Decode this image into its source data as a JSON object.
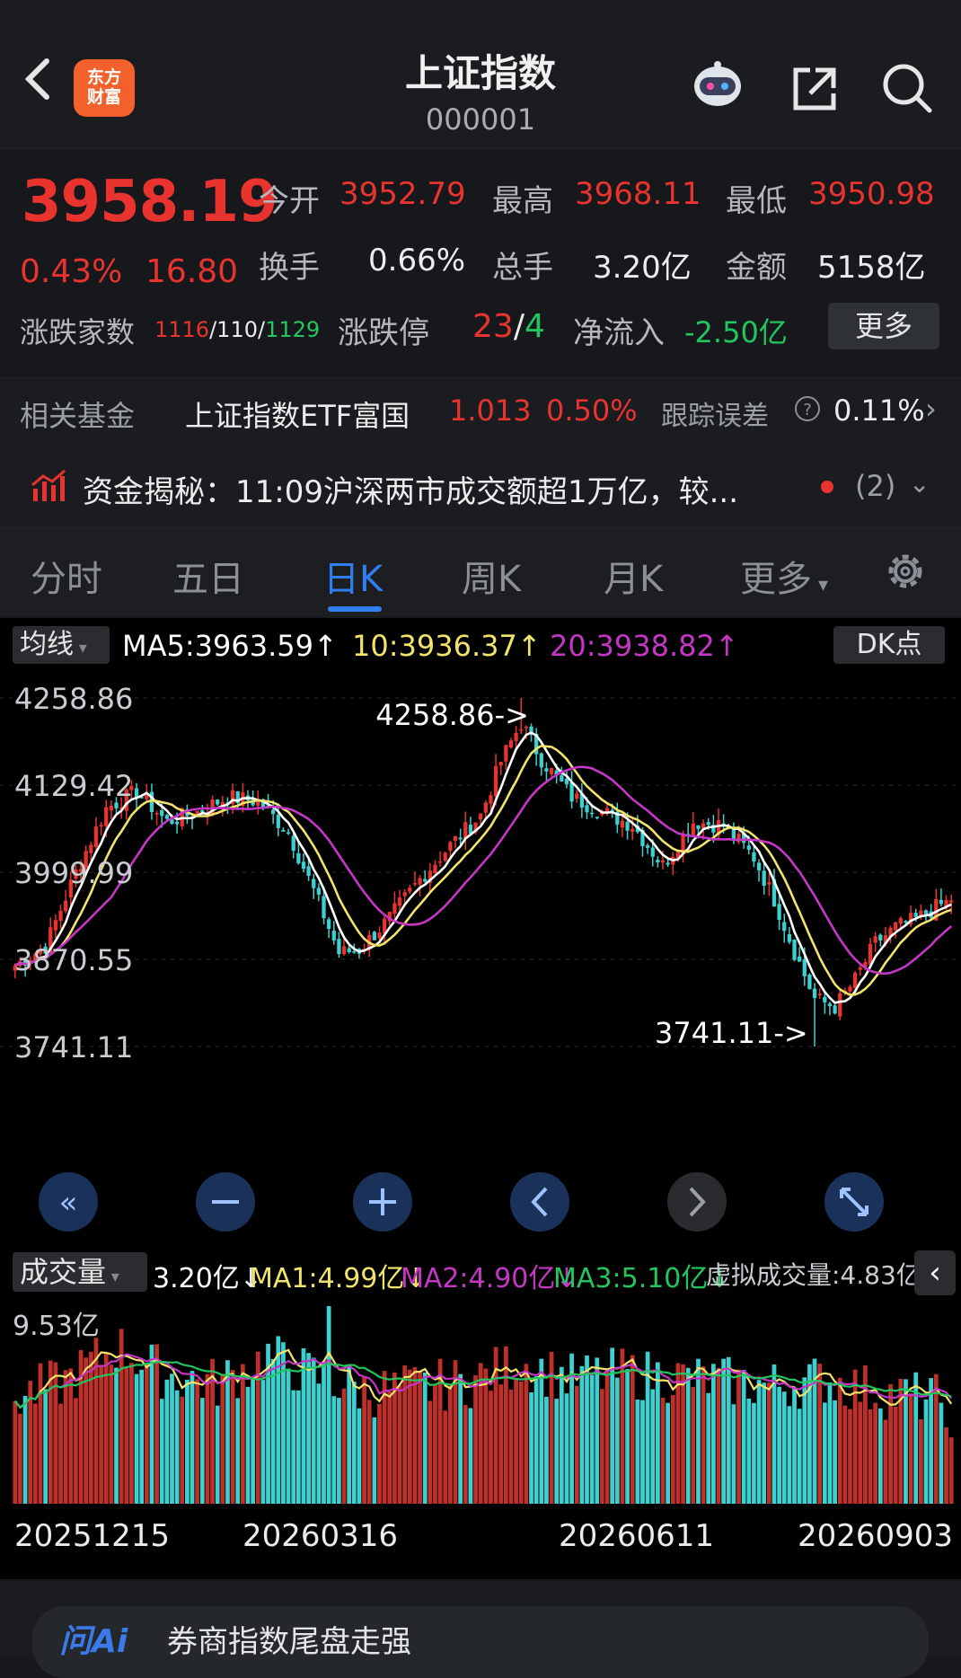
{
  "header": {
    "back_icon": "chevron-left-icon",
    "logo_line1": "东方",
    "logo_line2": "财富",
    "title": "上证指数",
    "code": "000001"
  },
  "quote": {
    "price": "3958.19",
    "change_pct": "0.43%",
    "change": "16.80",
    "open_label": "今开",
    "open": "3952.79",
    "high_label": "最高",
    "high": "3968.11",
    "low_label": "最低",
    "low": "3950.98",
    "turnover_label": "换手",
    "turnover": "0.66%",
    "volume_label": "总手",
    "volume": "3.20亿",
    "amount_label": "金额",
    "amount": "5158亿",
    "breadth_label": "涨跌家数",
    "up": "1116",
    "flat": "110",
    "down": "1129",
    "limit_label": "涨跌停",
    "limit_up": "23",
    "limit_down": "4",
    "netflow_label": "净流入",
    "netflow": "-2.50亿",
    "more_button": "更多"
  },
  "fund": {
    "label": "相关基金",
    "name": "上证指数ETF富国",
    "price": "1.013",
    "pct": "0.50%",
    "err_label": "跟踪误差",
    "err": "0.11%"
  },
  "news": {
    "text": "资金揭秘：11:09沪深两市成交额超1万亿，较...",
    "count": "(2)"
  },
  "tabs": [
    "分时",
    "五日",
    "日K",
    "周K",
    "月K",
    "更多"
  ],
  "active_tab": "日K",
  "ma_bar": {
    "selector": "均线",
    "ma5": "MA5:3963.59↑",
    "ma10": "10:3936.37↑",
    "ma20": "20:3938.82↑",
    "dk": "DK点"
  },
  "volume_bar": {
    "selector": "成交量",
    "vol": "3.20亿↓",
    "ma1": "MA1:4.99亿↓",
    "ma2": "MA2:4.90亿↓",
    "ma3": "MA3:5.10亿↓",
    "virtual": "虚拟成交量:4.83亿"
  },
  "bottom": {
    "text": "券商指数尾盘走强"
  },
  "colors": {
    "up": "#e8332e",
    "down": "#3dd0d0",
    "ma5": "#ffffff",
    "ma10": "#f2e36b",
    "ma20": "#c437c4",
    "accent": "#2f7ff0"
  },
  "chart_data": {
    "type": "candlestick",
    "y_axis_labels": [
      "4258.86",
      "4129.42",
      "3999.99",
      "3870.55",
      "3741.11"
    ],
    "ylim": [
      3741.11,
      4258.86
    ],
    "max_annotation": "4258.86->",
    "min_annotation": "3741.11->",
    "x_labels": [
      "20251215",
      "20260316",
      "20260611",
      "20260903"
    ],
    "volume_max_label": "9.53亿",
    "close_anchors": [
      [
        0,
        3862
      ],
      [
        6,
        3890
      ],
      [
        12,
        4000
      ],
      [
        18,
        4095
      ],
      [
        24,
        4120
      ],
      [
        30,
        4075
      ],
      [
        36,
        4090
      ],
      [
        42,
        4112
      ],
      [
        48,
        4105
      ],
      [
        54,
        4060
      ],
      [
        60,
        3955
      ],
      [
        64,
        3880
      ],
      [
        68,
        3885
      ],
      [
        74,
        3932
      ],
      [
        80,
        3990
      ],
      [
        86,
        4040
      ],
      [
        92,
        4085
      ],
      [
        96,
        4165
      ],
      [
        100,
        4222
      ],
      [
        104,
        4168
      ],
      [
        110,
        4112
      ],
      [
        116,
        4090
      ],
      [
        122,
        4070
      ],
      [
        128,
        4010
      ],
      [
        134,
        4075
      ],
      [
        140,
        4070
      ],
      [
        146,
        4022
      ],
      [
        150,
        3960
      ],
      [
        154,
        3882
      ],
      [
        158,
        3812
      ],
      [
        162,
        3800
      ],
      [
        166,
        3840
      ],
      [
        170,
        3895
      ],
      [
        174,
        3918
      ],
      [
        178,
        3930
      ],
      [
        182,
        3948
      ],
      [
        185,
        3958.19
      ]
    ],
    "vol_anchors": [
      [
        0,
        5.1
      ],
      [
        10,
        5.9
      ],
      [
        20,
        7.6
      ],
      [
        30,
        6.2
      ],
      [
        40,
        5.8
      ],
      [
        50,
        7.1
      ],
      [
        60,
        6.1
      ],
      [
        70,
        5.4
      ],
      [
        80,
        5.6
      ],
      [
        90,
        5.9
      ],
      [
        100,
        6.8
      ],
      [
        110,
        6.0
      ],
      [
        120,
        6.3
      ],
      [
        130,
        6.1
      ],
      [
        140,
        5.9
      ],
      [
        150,
        5.7
      ],
      [
        160,
        6.0
      ],
      [
        170,
        5.4
      ],
      [
        185,
        4.9
      ]
    ],
    "ma5_last": 3963.59,
    "ma10_last": 3936.37,
    "ma20_last": 3938.82
  }
}
